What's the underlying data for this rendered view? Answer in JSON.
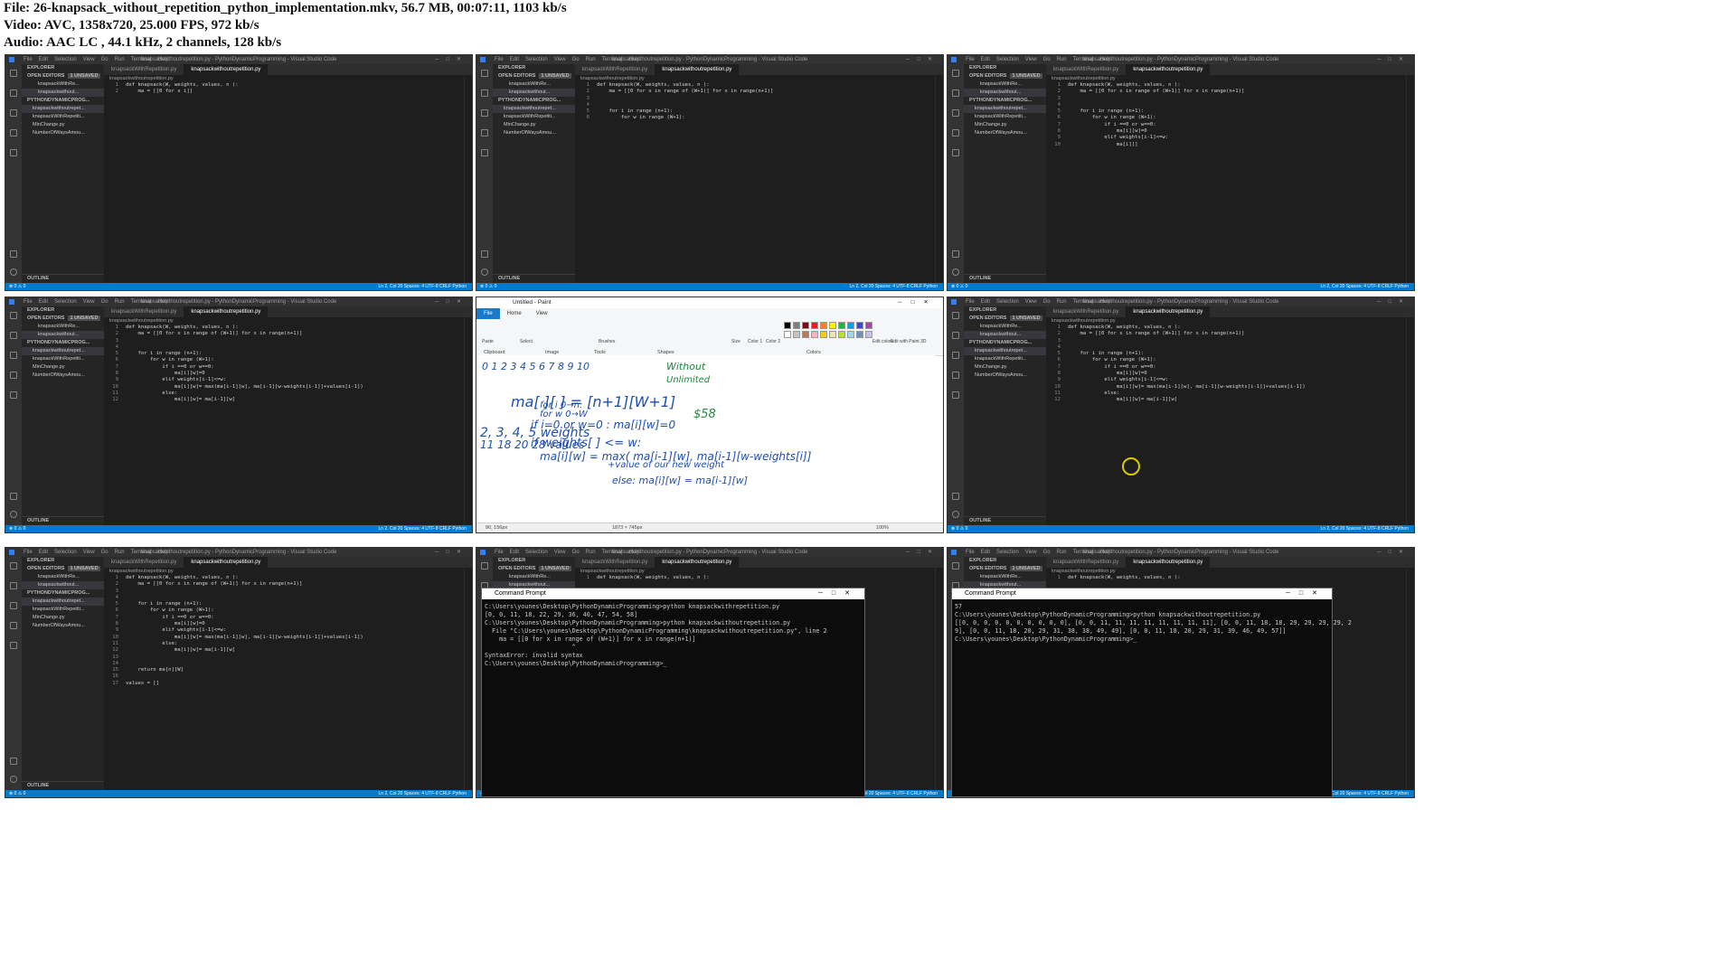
{
  "header": {
    "line1": "File: 26-knapsack_without_repetition_python_implementation.mkv, 56.7 MB, 00:07:11, 1103 kb/s",
    "line2": "Video: AVC, 1358x720, 25.000 FPS, 972 kb/s",
    "line3": "Audio: AAC LC , 44.1 kHz, 2 channels, 128 kb/s"
  },
  "vscode": {
    "menu": [
      "File",
      "Edit",
      "Selection",
      "View",
      "Go",
      "Run",
      "Terminal",
      "Help"
    ],
    "window_title": "knapsackwithoutrepetition.py - PythonDynamicProgramming - Visual Studio Code",
    "tab_inactive": "knapsackWithRepetition.py",
    "tab_active": "knapsackwithoutrepetition.py",
    "breadcrumb": "knapsackwithoutrepetition.py",
    "explorer_label": "EXPLORER",
    "open_editors": "OPEN EDITORS",
    "unsaved_badge": "1 UNSAVED",
    "open_items": [
      "knapsackWithRe...",
      "knapsackwithout..."
    ],
    "project": "PYTHONDYNAMICPROG...",
    "files": [
      "knapsackwithoutrepet...",
      "knapsackWithRepetiti...",
      "MinChange.py",
      "NumberOfWaysAmou..."
    ],
    "outline": "OUTLINE",
    "status_right": "Ln 2, Col 20   Spaces: 4   UTF-8   CRLF   Python"
  },
  "code_snippets": {
    "t1": [
      "def knapsack(W, weights, values, n ):",
      "    ma = [[0 for x i]]"
    ],
    "t2": [
      "def knapsack(W, weights, values, n ):",
      "    ma = [[0 for x in range of (W+1)] for x in range(n+1)]",
      "",
      "",
      "    for i in range (n+1):",
      "        for w in range (W+1):"
    ],
    "t3": [
      "def knapsack(W, weights, values, n ):",
      "    ma = [[0 for x in range of (W+1)] for x in range(n+1)]",
      "",
      "",
      "    for i in range (n+1):",
      "        for w in range (W+1):",
      "            if i ==0 or w==0:",
      "                ma[i][w]=0",
      "            elif weights[i-1]<=w:",
      "                ma[i][]"
    ],
    "t4": [
      "def knapsack(W, weights, values, n ):",
      "    ma = [[0 for x in range of (W+1)] for x in range(n+1)]",
      "",
      "",
      "    for i in range (n+1):",
      "        for w in range (W+1):",
      "            if i ==0 or w==0:",
      "                ma[i][w]=0",
      "            elif weights[i-1]<=w:",
      "                ma[i][w]= max(ma[i-1][w], ma[i-1][w-weights[i-1]]+values[i-1])",
      "            else:",
      "                ma[i][w]= ma[i-1][w]"
    ],
    "t7": [
      "def knapsack(W, weights, values, n ):",
      "    ma = [[0 for x in range of (W+1)] for x in range(n+1)]",
      "",
      "",
      "    for i in range (n+1):",
      "        for w in range (W+1):",
      "            if i ==0 or w==0:",
      "                ma[i][w]=0",
      "            elif weights[i-1]<=w:",
      "                ma[i][w]= max(ma[i-1][w], ma[i-1][w-weights[i-1]]+values[i-1])",
      "            else:",
      "                ma[i][w]= ma[i-1][w]",
      "",
      "",
      "    return ma[n][W]",
      "",
      "values = []"
    ],
    "t8": [
      "def knapsack(W, weights, values, n ):"
    ],
    "t9": [
      "def knapsack(W, weights, values, n ):"
    ]
  },
  "paint": {
    "title": "Untitled - Paint",
    "tabs": [
      "File",
      "Home",
      "View"
    ],
    "groups": [
      "Clipboard",
      "Image",
      "Tools",
      "Shapes",
      "Colors"
    ],
    "buttons": [
      "Paste",
      "Select",
      "Brushes",
      "Size",
      "Color 1",
      "Color 2",
      "Edit colors",
      "Edit with Paint 3D"
    ],
    "status_pos": "90, 156px",
    "status_size": "1873 × 745px",
    "zoom": "100%",
    "palette": [
      "#000000",
      "#7f7f7f",
      "#880015",
      "#ed1c24",
      "#ff7f27",
      "#fff200",
      "#22b14c",
      "#00a2e8",
      "#3f48cc",
      "#a349a4",
      "#ffffff",
      "#c3c3c3",
      "#b97a57",
      "#ffaec9",
      "#ffc90e",
      "#efe4b0",
      "#b5e61d",
      "#99d9ea",
      "#7092be",
      "#c8bfe7"
    ],
    "notes": [
      "0 1 2 3 4 5 6 7 8 9 10",
      "ma[ ][ ] = [n+1][W+1]",
      "2, 3, 4, 5 weights",
      "11 18 20 28 values",
      "for i 0→n:",
      "for w 0→W",
      "if i=0 or w=0 : ma[i][w]=0",
      "if weights[ ] <= w:",
      "ma[i][w] = max( ma[i-1][w], ma[i-1][w-weights[i]]",
      "+value of our new weight",
      "else: ma[i][w] = ma[i-1][w]",
      "Without",
      "Unlimited",
      "$58"
    ]
  },
  "cmd": {
    "title": "Command Prompt",
    "t8_lines": [
      "C:\\Users\\younes\\Desktop\\PythonDynamicProgramming>python knapsackwithrepetition.py",
      "[0, 0, 11, 18, 22, 29, 36, 40, 47, 54, 58]",
      "",
      "C:\\Users\\younes\\Desktop\\PythonDynamicProgramming>python knapsackwithoutrepetition.py",
      "  File \"C:\\Users\\younes\\Desktop\\PythonDynamicProgramming\\knapsackwithoutrepetition.py\", line 2",
      "    ma = [[0 for x in range of (W+1)] for x in range(n+1)]",
      "                        ^",
      "SyntaxError: invalid syntax",
      "",
      "C:\\Users\\younes\\Desktop\\PythonDynamicProgramming>_"
    ],
    "t9_lines": [
      "57",
      "",
      "C:\\Users\\younes\\Desktop\\PythonDynamicProgramming>python knapsackwithoutrepetition.py",
      "[[0, 0, 0, 0, 0, 0, 0, 0, 0, 0], [0, 0, 11, 11, 11, 11, 11, 11, 11, 11], [0, 0, 11, 18, 18, 29, 29, 29, 29, 2",
      "9], [0, 0, 11, 18, 20, 29, 31, 38, 38, 49, 49], [0, 0, 11, 18, 20, 29, 31, 39, 46, 49, 57]]",
      "",
      "C:\\Users\\younes\\Desktop\\PythonDynamicProgramming>_"
    ]
  }
}
